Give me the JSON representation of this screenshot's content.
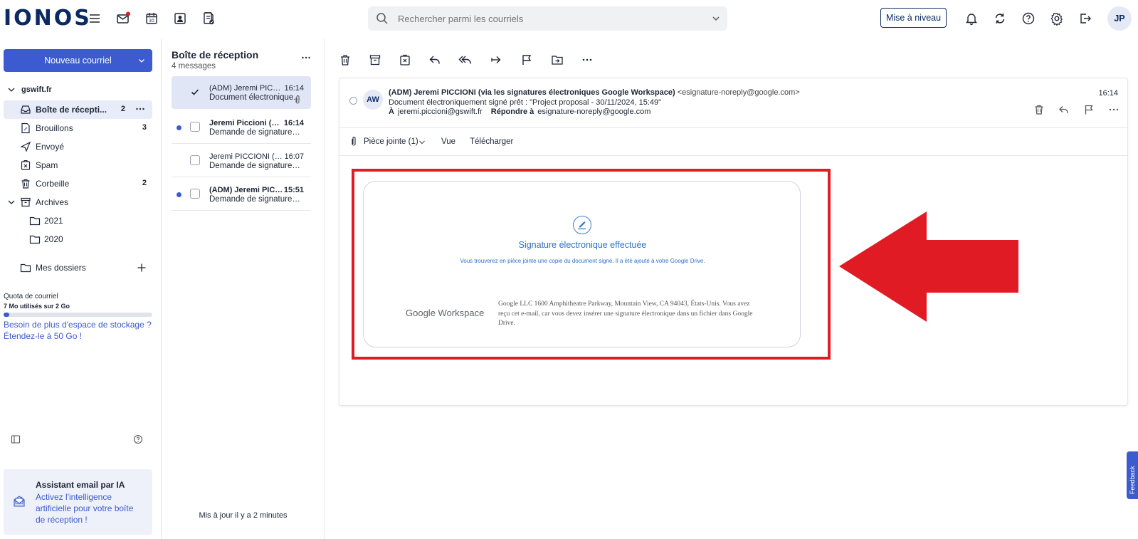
{
  "app": {
    "logo": "IONOS",
    "search_placeholder": "Rechercher parmi les courriels",
    "upgrade_label": "Mise à niveau",
    "avatar_initials": "JP",
    "calendar_day": "30",
    "brand_color": "#3c5bd1",
    "accent_red": "#e01b24"
  },
  "sidebar": {
    "new_mail_label": "Nouveau courriel",
    "account": "gswift.fr",
    "folders": [
      {
        "label": "Boîte de récepti...",
        "count": "2",
        "icon": "inbox-icon"
      },
      {
        "label": "Brouillons",
        "count": "3",
        "icon": "draft-icon"
      },
      {
        "label": "Envoyé",
        "count": "",
        "icon": "send-icon"
      },
      {
        "label": "Spam",
        "count": "",
        "icon": "spam-icon"
      },
      {
        "label": "Corbeille",
        "count": "2",
        "icon": "trash-icon"
      },
      {
        "label": "Archives",
        "count": "",
        "icon": "archive-icon"
      },
      {
        "label": "2021",
        "count": "",
        "icon": "folder-icon"
      },
      {
        "label": "2020",
        "count": "",
        "icon": "folder-icon"
      }
    ],
    "my_folders_label": "Mes dossiers",
    "quota_label": "Quota de courriel",
    "quota_used": "7 Mo utilisés sur 2 Go",
    "quota_fraction": 0.04,
    "quota_link": "Besoin de plus d'espace de stockage ? Étendez-le à 50 Go !",
    "ai_title": "Assistant email par IA",
    "ai_text": "Activez l'intelligence artificielle pour votre boîte de réception !"
  },
  "list": {
    "title": "Boîte de réception",
    "count": "4 messages",
    "messages": [
      {
        "from": "(ADM) Jeremi PICCIONI (via les signatures électroniques Google Workspace)",
        "subject": "Document électronique...",
        "time": "16:14"
      },
      {
        "from": "Jeremi Piccioni (via les signatures électroniques Google Workspace)",
        "subject": "Demande de signature électronique",
        "time": "16:14"
      },
      {
        "from": "Jeremi PICCIONI (via les signatures électroniques Google Workspace)",
        "subject": "Demande de signature électronique",
        "time": "16:07"
      },
      {
        "from": "(ADM) Jeremi PICCIONI (via les signatures électroniques Google Workspace)",
        "subject": "Demande de signature électronique",
        "time": "15:51"
      }
    ],
    "updated": "Mis à jour il y a 2 minutes"
  },
  "reader": {
    "avatar_initials": "AW",
    "from_name": "(ADM) Jeremi PICCIONI (via les signatures électroniques Google Workspace)",
    "from_email": "<esignature-noreply@google.com>",
    "subject": "Document électroniquement signé prêt : \"Project proposal - 30/11/2024, 15:49\"",
    "to_label": "À",
    "to_value": "jeremi.piccioni@gswift.fr",
    "reply_label": "Répondre à",
    "reply_value": "esignature-noreply@google.com",
    "time": "16:14",
    "attachment_label": "Pièce jointe (1)",
    "view_label": "Vue",
    "download_label": "Télécharger"
  },
  "card": {
    "title": "Signature électronique effectuée",
    "subtitle": "Vous trouverez en pièce jointe une copie du document signé. Il a été ajouté à votre Google Drive.",
    "logo_text": "Google Workspace",
    "address": "Google LLC 1600 Amphitheatre Parkway, Mountain View, CA 94043, États-Unis. Vous avez reçu cet e-mail, car vous devez insérer une signature électronique dans un fichier dans Google Drive."
  },
  "feedback_label": "Feedback"
}
